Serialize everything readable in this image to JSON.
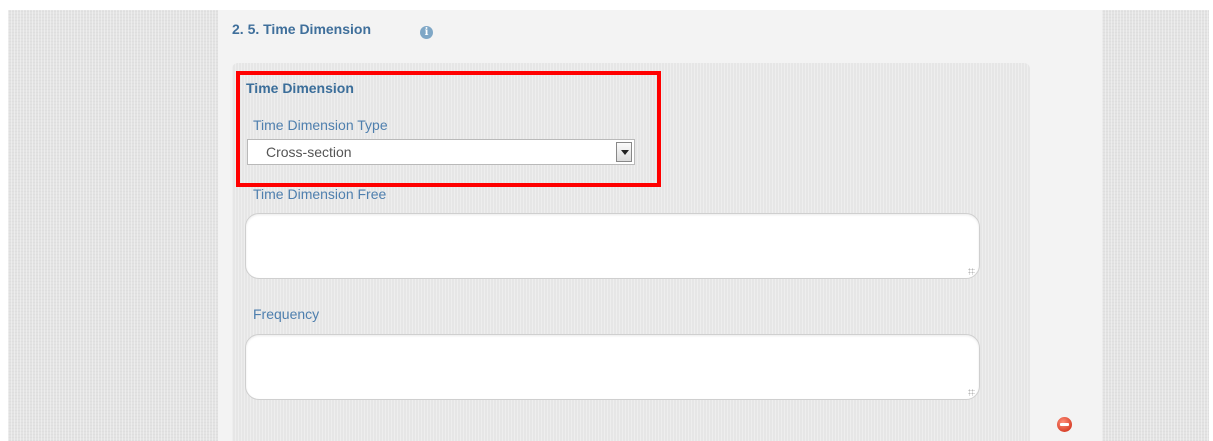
{
  "section": {
    "title": "2. 5. Time Dimension",
    "info_icon": "info-icon"
  },
  "group": {
    "title": "Time Dimension"
  },
  "fields": {
    "time_dimension_type": {
      "label": "Time Dimension Type",
      "value": "Cross-section"
    },
    "time_dimension_free": {
      "label": "Time Dimension Free",
      "value": ""
    },
    "frequency": {
      "label": "Frequency",
      "value": ""
    }
  },
  "icons": {
    "remove": "remove-icon",
    "dropdown": "chevron-down-icon"
  },
  "colors": {
    "label": "#4e7fae",
    "title": "#3f6f9b",
    "highlight": "#ff0000",
    "remove": "#d9432c"
  }
}
